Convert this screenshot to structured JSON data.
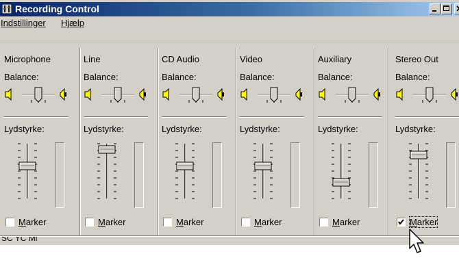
{
  "window": {
    "title": "Recording Control"
  },
  "menu": {
    "items": [
      {
        "label": "Indstillinger"
      },
      {
        "label": "Hjælp"
      }
    ]
  },
  "channels": [
    {
      "name": "Microphone",
      "balance_label": "Balance:",
      "volume_label": "Lydstyrke:",
      "volume_level": 0.6,
      "select_label": "Marker",
      "selected": false
    },
    {
      "name": "Line",
      "balance_label": "Balance:",
      "volume_label": "Lydstyrke:",
      "volume_level": 0.9,
      "select_label": "Marker",
      "selected": false
    },
    {
      "name": "CD Audio",
      "balance_label": "Balance:",
      "volume_label": "Lydstyrke:",
      "volume_level": 0.6,
      "select_label": "Marker",
      "selected": false
    },
    {
      "name": "Video",
      "balance_label": "Balance:",
      "volume_label": "Lydstyrke:",
      "volume_level": 0.6,
      "select_label": "Marker",
      "selected": false
    },
    {
      "name": "Auxiliary",
      "balance_label": "Balance:",
      "volume_label": "Lydstyrke:",
      "volume_level": 0.3,
      "select_label": "Marker",
      "selected": false
    },
    {
      "name": "Stereo Out",
      "balance_label": "Balance:",
      "volume_label": "Lydstyrke:",
      "volume_level": 0.8,
      "select_label": "Marker",
      "selected": true
    }
  ],
  "status": {
    "text": "SC YC Mi"
  }
}
